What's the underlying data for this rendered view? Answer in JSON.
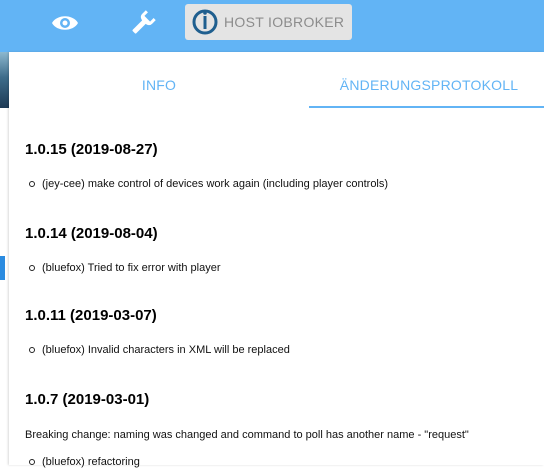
{
  "toolbar": {
    "host_label": "HOST IOBROKER"
  },
  "tabs": [
    {
      "label": "INFO"
    },
    {
      "label": "ÄNDERUNGSPROTOKOLL"
    }
  ],
  "changelog": [
    {
      "version": "1.0.15 (2019-08-27)",
      "entries": [
        "(jey-cee) make control of devices work again (including player controls)"
      ]
    },
    {
      "version": "1.0.14 (2019-08-04)",
      "entries": [
        "(bluefox) Tried to fix error with player"
      ]
    },
    {
      "version": "1.0.11 (2019-03-07)",
      "entries": [
        "(bluefox) Invalid characters in XML will be replaced"
      ]
    },
    {
      "version": "1.0.7 (2019-03-01)",
      "note": "Breaking change: naming was changed and command to poll has another name - \"request\"",
      "entries": [
        "(bluefox) refactoring"
      ]
    }
  ],
  "colors": {
    "accent": "#62b4f5",
    "host_button": "#e4e4e4"
  },
  "icons": [
    "eye-icon",
    "wrench-icon",
    "iobroker-logo-icon"
  ]
}
